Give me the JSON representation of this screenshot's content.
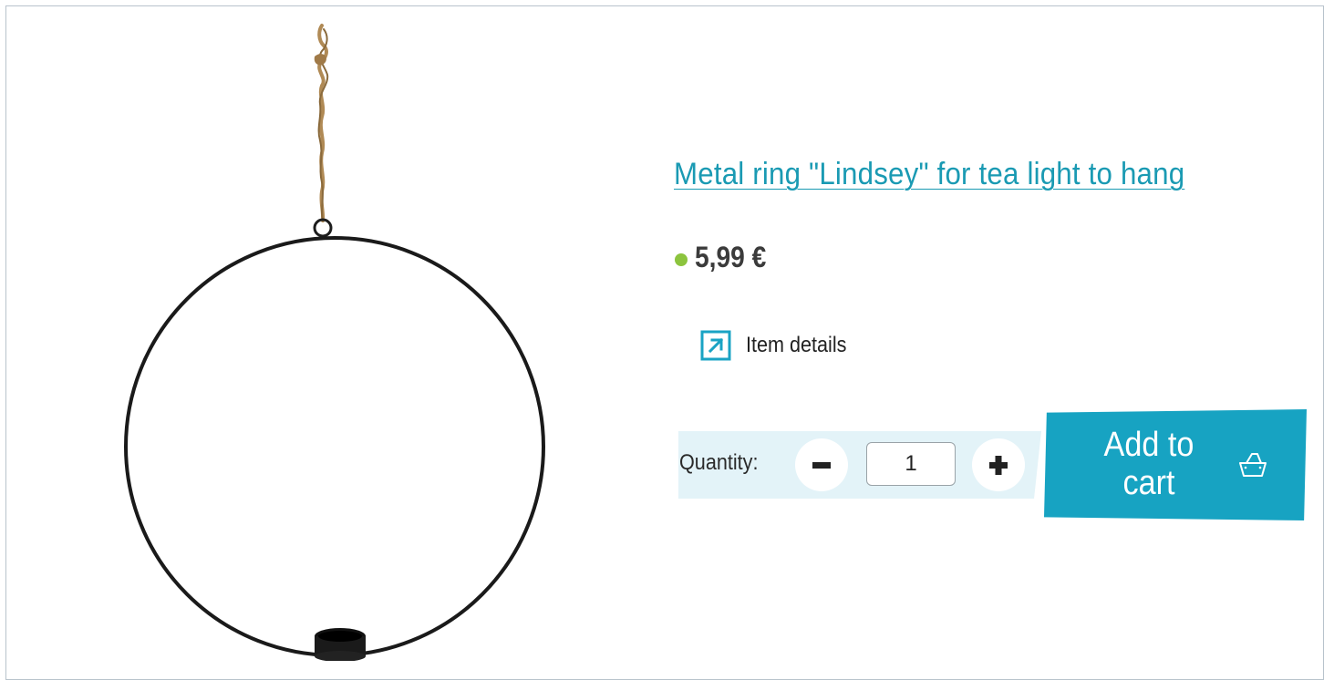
{
  "product": {
    "title": "Metal ring \"Lindsey\" for tea light to hang",
    "price": "5,99 €",
    "availability_color": "#8cc43e",
    "image_icon": "hanging-metal-ring-tealight"
  },
  "details": {
    "label": "Item details",
    "icon": "external-arrow-icon"
  },
  "quantity": {
    "label": "Quantity:",
    "value": "1",
    "minus_icon": "minus-icon",
    "plus_icon": "plus-icon"
  },
  "cart": {
    "label": "Add to cart",
    "icon": "basket-icon"
  },
  "colors": {
    "accent": "#17a3c2",
    "link": "#1a9ab3",
    "panel": "#e3f3f8"
  }
}
